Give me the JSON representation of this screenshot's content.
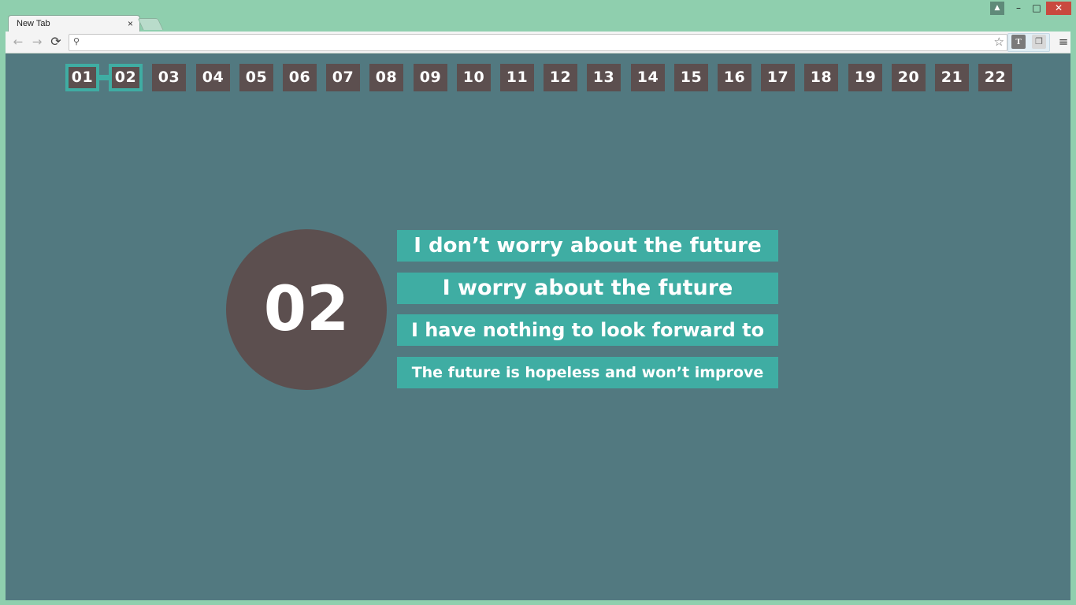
{
  "browser": {
    "tab_title": "New Tab",
    "tab_close": "×",
    "window_buttons": {
      "user": "▲",
      "minimize": "–",
      "maximize": "□",
      "close": "✕"
    },
    "nav": {
      "back": "←",
      "forward": "→",
      "reload": "⟳"
    },
    "omnibox": {
      "value": "",
      "search_icon": "⚲",
      "star": "☆"
    },
    "extensions": {
      "t_label": "T",
      "p_label": "❐"
    },
    "menu": "≡"
  },
  "pager": {
    "items": [
      "01",
      "02",
      "03",
      "04",
      "05",
      "06",
      "07",
      "08",
      "09",
      "10",
      "11",
      "12",
      "13",
      "14",
      "15",
      "16",
      "17",
      "18",
      "19",
      "20",
      "21",
      "22"
    ],
    "visited": [
      "01",
      "02"
    ]
  },
  "question": {
    "number": "02",
    "answers": [
      "I don’t worry about the future",
      "I worry about the future",
      "I have nothing to look forward to",
      "The future is hopeless and won’t improve"
    ]
  },
  "colors": {
    "page_bg": "#527980",
    "chrome": "#8fcfae",
    "tile": "#5c4f4f",
    "accent": "#3fada3",
    "text": "#ffffff"
  }
}
